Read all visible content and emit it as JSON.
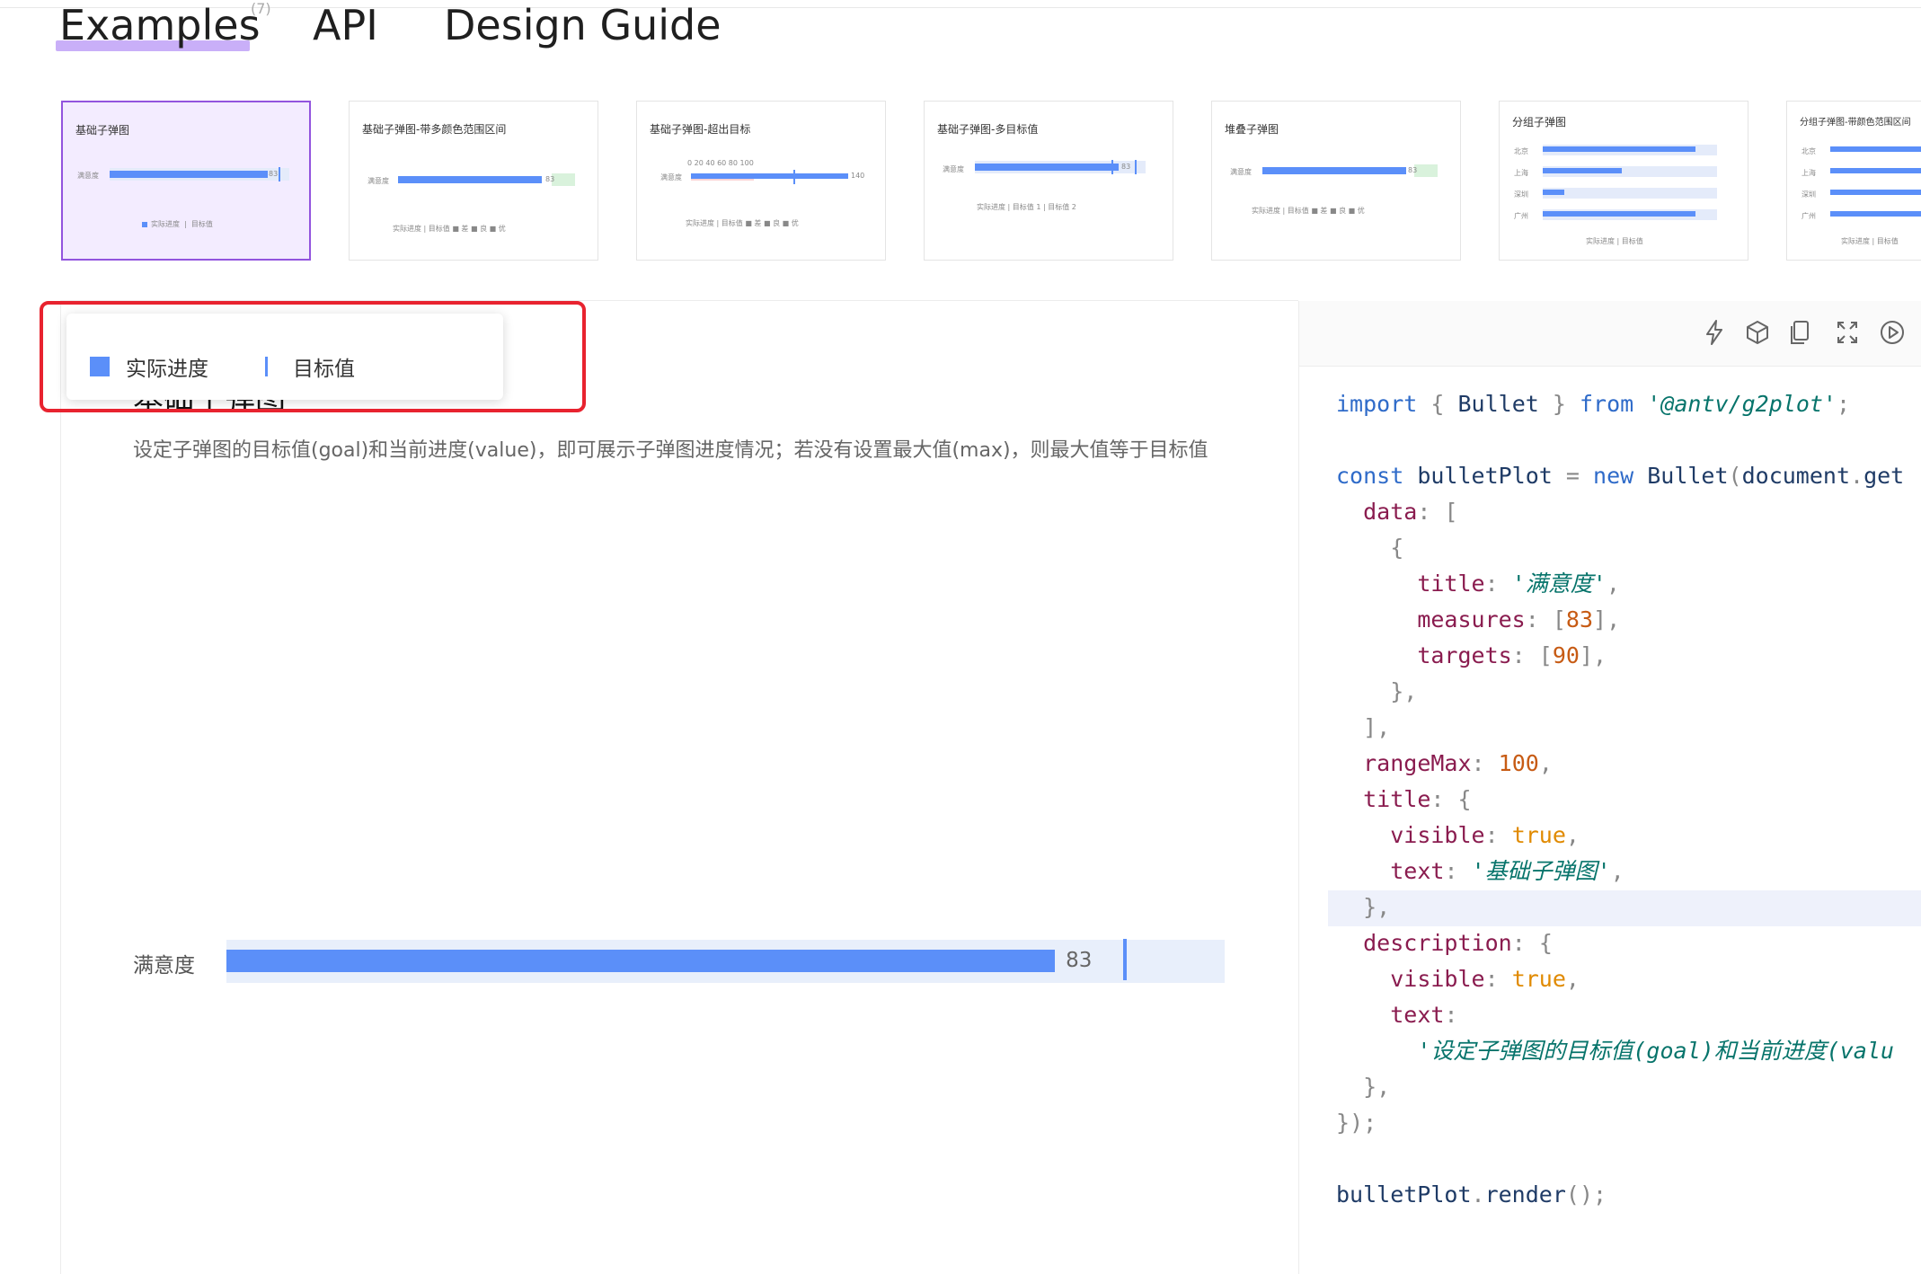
{
  "nav": {
    "tabs": [
      "Examples",
      "API",
      "Design Guide"
    ],
    "examples_count": "(7)"
  },
  "thumbnails": [
    {
      "title": "基础子弹图",
      "label": "满意度",
      "value": "83",
      "legend": [
        "实际进度",
        "目标值"
      ]
    },
    {
      "title": "基础子弹图-带多颜色范围区间",
      "label": "满意度",
      "value": "83",
      "legend": "实际进度 | 目标值 ■ 差 ■ 良 ■ 优"
    },
    {
      "title": "基础子弹图-超出目标",
      "label": "满意度",
      "value": "140",
      "ticks": "0 20 40 60 80 100",
      "legend": "实际进度 | 目标值 ■ 差 ■ 良 ■ 优"
    },
    {
      "title": "基础子弹图-多目标值",
      "label": "满意度",
      "value": "83",
      "legend": "实际进度 | 目标值 1 | 目标值 2"
    },
    {
      "title": "堆叠子弹图",
      "label": "满意度",
      "value": "83",
      "legend": "实际进度 | 目标值 ■ 差 ■ 良 ■ 优"
    },
    {
      "title": "分组子弹图",
      "rows": [
        "北京",
        "上海",
        "深圳",
        "广州"
      ],
      "legend": "实际进度 | 目标值"
    },
    {
      "title": "分组子弹图-带颜色范围区间",
      "rows": [
        "北京",
        "上海",
        "深圳",
        "广州"
      ],
      "legend": "实际进度 | 目标值"
    }
  ],
  "legend": {
    "actual": "实际进度",
    "target": "目标值"
  },
  "chart": {
    "title": "基础子弹图",
    "description": "设定子弹图的目标值(goal)和当前进度(value)，即可展示子弹图进度情况；若没有设置最大值(max)，则最大值等于目标值"
  },
  "chart_data": {
    "type": "bar",
    "orientation": "horizontal",
    "categories": [
      "满意度"
    ],
    "series": [
      {
        "name": "实际进度",
        "values": [
          83
        ]
      },
      {
        "name": "目标值",
        "values": [
          90
        ]
      }
    ],
    "range_max": 100,
    "title": "基础子弹图",
    "colors": {
      "bar": "#5b8ff9",
      "range": "#e8effb"
    }
  },
  "code": {
    "lines": [
      "import { Bullet } from '@antv/g2plot';",
      "",
      "const bulletPlot = new Bullet(document.get",
      "  data: [",
      "    {",
      "      title: '满意度',",
      "      measures: [83],",
      "      targets: [90],",
      "    },",
      "  ],",
      "  rangeMax: 100,",
      "  title: {",
      "    visible: true,",
      "    text: '基础子弹图',",
      "  },",
      "  description: {",
      "    visible: true,",
      "    text:",
      "      '设定子弹图的目标值(goal)和当前进度(valu",
      "  },",
      "});",
      "",
      "bulletPlot.render();"
    ]
  },
  "toolbar_icons": [
    "lightning-icon",
    "cube-icon",
    "copy-icon",
    "fullscreen-icon",
    "play-icon"
  ]
}
